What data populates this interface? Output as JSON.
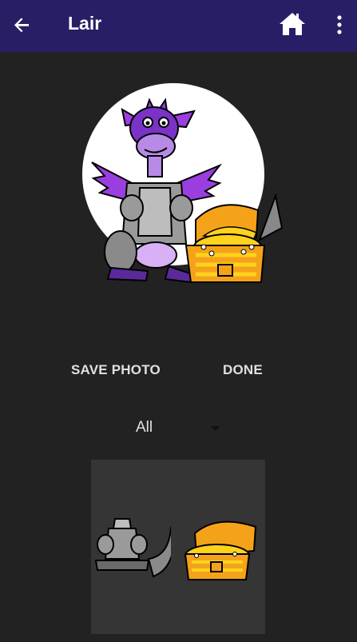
{
  "app_bar": {
    "title": "Lair",
    "back_icon": "arrow-back-icon",
    "home_icon": "home-icon",
    "more_icon": "more-vert-icon",
    "background_color": "#261f66"
  },
  "preview": {
    "image_alt": "dragon knight with treasure chest"
  },
  "actions": {
    "save_photo_label": "SAVE PHOTO",
    "done_label": "DONE"
  },
  "filter": {
    "selected": "All"
  },
  "sticker_grid": {
    "items": [
      {
        "name": "knight-armor-sticker"
      },
      {
        "name": "treasure-chest-sticker"
      }
    ]
  }
}
